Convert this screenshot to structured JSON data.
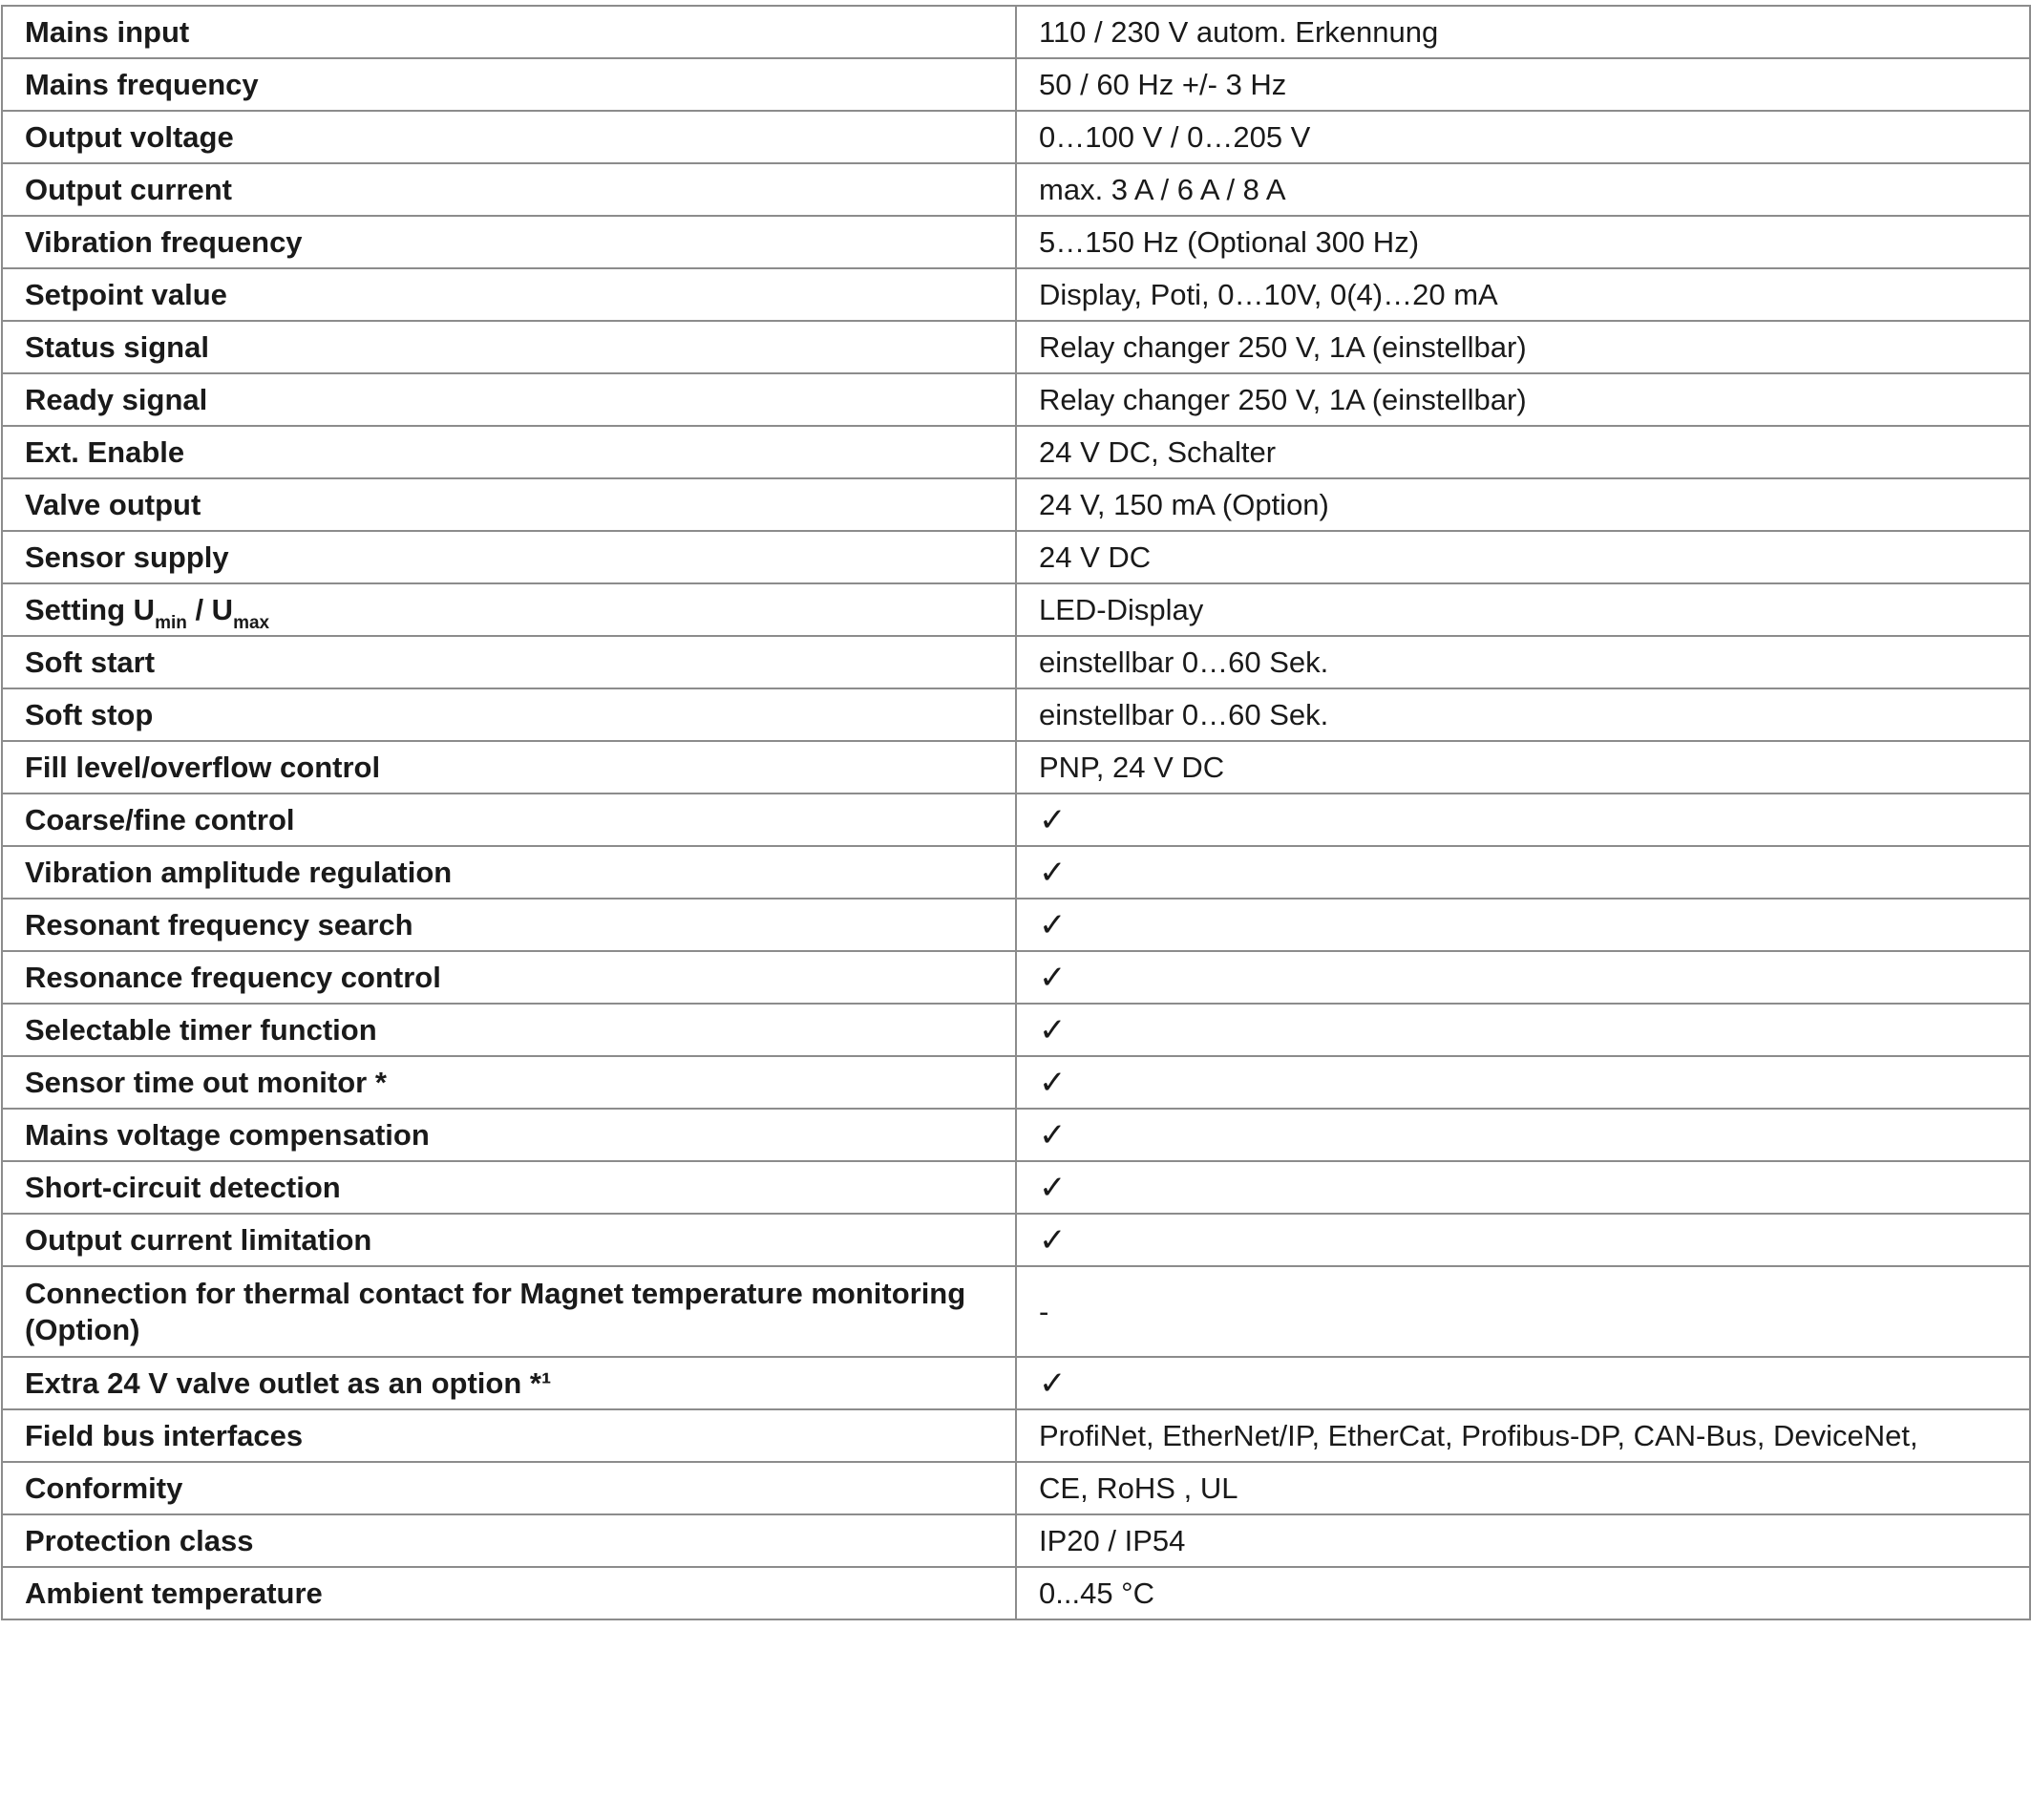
{
  "rows": [
    {
      "label": "Mains input",
      "value": "110 / 230 V autom. Erkennung"
    },
    {
      "label": "Mains frequency",
      "value": "50 / 60 Hz +/- 3 Hz"
    },
    {
      "label": "Output voltage",
      "value": "0…100 V / 0…205 V"
    },
    {
      "label": "Output current",
      "value": "max. 3 A / 6 A / 8 A"
    },
    {
      "label": "Vibration frequency",
      "value": "5…150 Hz (Optional 300 Hz)"
    },
    {
      "label": "Setpoint value",
      "value": "Display, Poti, 0…10V, 0(4)…20 mA"
    },
    {
      "label": "Status signal",
      "value": "Relay changer 250 V, 1A (einstellbar)"
    },
    {
      "label": "Ready signal",
      "value": "Relay changer 250 V, 1A (einstellbar)"
    },
    {
      "label": "Ext. Enable",
      "value": "24 V DC, Schalter"
    },
    {
      "label": "Valve output",
      "value": "24 V, 150 mA (Option)"
    },
    {
      "label": "Sensor supply",
      "value": "24 V DC"
    },
    {
      "label_parts": {
        "pre": "Setting U",
        "sub1": "min",
        "mid": " / U",
        "sub2": "max"
      },
      "value": "LED-Display"
    },
    {
      "label": "Soft start",
      "value": "einstellbar 0…60 Sek."
    },
    {
      "label": "Soft stop",
      "value": "einstellbar 0…60 Sek."
    },
    {
      "label": "Fill level/overflow control",
      "value": "PNP, 24 V DC"
    },
    {
      "label": "Coarse/fine control",
      "value": "✓"
    },
    {
      "label": "Vibration amplitude regulation",
      "value": "✓"
    },
    {
      "label": "Resonant frequency search",
      "value": "✓"
    },
    {
      "label": "Resonance frequency control",
      "value": "✓"
    },
    {
      "label": "Selectable timer function",
      "value": "✓"
    },
    {
      "label": "Sensor time out monitor *",
      "value": "✓"
    },
    {
      "label": "Mains voltage compensation",
      "value": "✓"
    },
    {
      "label": "Short-circuit detection",
      "value": "✓"
    },
    {
      "label": "Output current limitation",
      "value": "✓"
    },
    {
      "label": "Connection for thermal contact for Magnet temperature monitoring (Option)",
      "value": "-"
    },
    {
      "label": "Extra 24 V valve outlet as an option *¹",
      "value": "✓"
    },
    {
      "label": "Field bus interfaces",
      "value": "ProfiNet, EtherNet/IP, EtherCat, Profibus-DP, CAN-Bus, DeviceNet,"
    },
    {
      "label": "Conformity",
      "value": "CE, RoHS , UL"
    },
    {
      "label": "Protection class",
      "value": "IP20 / IP54"
    },
    {
      "label": "Ambient temperature",
      "value": "0...45 °C"
    }
  ],
  "colors": {
    "border": "#8c8c8c",
    "text": "#1a1a1a",
    "background": "#ffffff"
  }
}
